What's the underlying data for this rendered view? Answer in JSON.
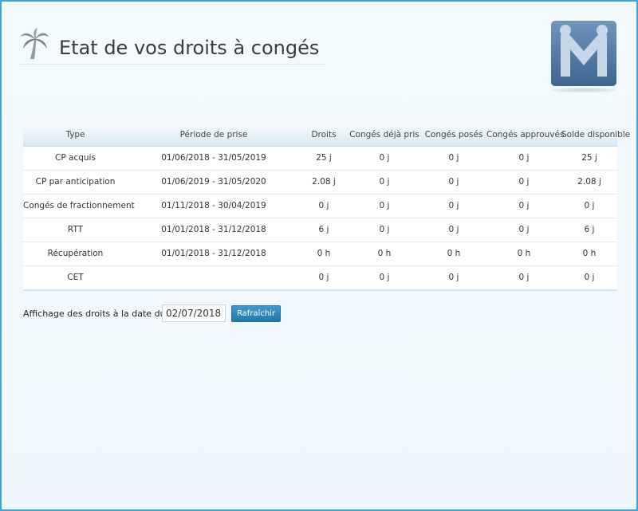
{
  "header": {
    "title": "Etat de vos droits à congés",
    "icon": "palm-tree-icon",
    "logo_icon": "m-logo-icon"
  },
  "table": {
    "columns": [
      "Type",
      "Période de prise",
      "Droits",
      "Congés déjà pris",
      "Congés posés",
      "Congés approuvés",
      "Solde disponible"
    ],
    "rows": [
      [
        "CP acquis",
        "01/06/2018 - 31/05/2019",
        "25 j",
        "0 j",
        "0 j",
        "0 j",
        "25 j"
      ],
      [
        "CP par anticipation",
        "01/06/2019 - 31/05/2020",
        "2.08 j",
        "0 j",
        "0 j",
        "0 j",
        "2.08 j"
      ],
      [
        "Congés de fractionnement",
        "01/11/2018 - 30/04/2019",
        "0 j",
        "0 j",
        "0 j",
        "0 j",
        "0 j"
      ],
      [
        "RTT",
        "01/01/2018 - 31/12/2018",
        "6 j",
        "0 j",
        "0 j",
        "0 j",
        "6 j"
      ],
      [
        "Récupération",
        "01/01/2018 - 31/12/2018",
        "0 h",
        "0 h",
        "0 h",
        "0 h",
        "0 h"
      ],
      [
        "CET",
        "",
        "0 j",
        "0 j",
        "0 j",
        "0 j",
        "0 j"
      ]
    ]
  },
  "footer": {
    "label": "Affichage des droits à la date du :",
    "date_value": "02/07/2018",
    "refresh_label": "Rafraîchir"
  },
  "colors": {
    "accent": "#2a86b8",
    "border": "#3aa6dd",
    "background": "#f2f9fd"
  }
}
